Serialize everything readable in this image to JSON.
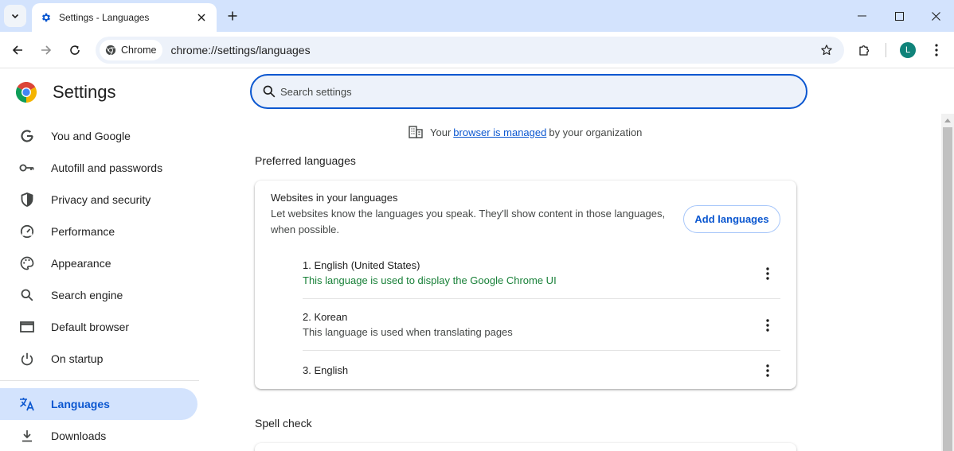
{
  "window": {
    "tab_title": "Settings - Languages"
  },
  "toolbar": {
    "chip_label": "Chrome",
    "url": "chrome://settings/languages",
    "avatar_letter": "L"
  },
  "sidebar": {
    "title": "Settings",
    "items": [
      {
        "label": "You and Google",
        "icon": "google-g-icon"
      },
      {
        "label": "Autofill and passwords",
        "icon": "key-icon"
      },
      {
        "label": "Privacy and security",
        "icon": "shield-icon"
      },
      {
        "label": "Performance",
        "icon": "speedometer-icon"
      },
      {
        "label": "Appearance",
        "icon": "palette-icon"
      },
      {
        "label": "Search engine",
        "icon": "search-icon"
      },
      {
        "label": "Default browser",
        "icon": "browser-window-icon"
      },
      {
        "label": "On startup",
        "icon": "power-icon"
      },
      {
        "label": "Languages",
        "icon": "translate-icon",
        "active": true
      },
      {
        "label": "Downloads",
        "icon": "download-icon"
      }
    ]
  },
  "main": {
    "search_placeholder": "Search settings",
    "managed": {
      "prefix": "Your",
      "link": "browser is managed",
      "suffix": "by your organization"
    },
    "preferred_title": "Preferred languages",
    "card": {
      "title": "Websites in your languages",
      "description": "Let websites know the languages you speak. They'll show content in those languages, when possible.",
      "add_button": "Add languages",
      "languages": [
        {
          "name": "1. English (United States)",
          "note": "This language is used to display the Google Chrome UI"
        },
        {
          "name": "2. Korean",
          "note": "This language is used when translating pages"
        },
        {
          "name": "3. English",
          "note": ""
        }
      ]
    },
    "spell_check_title": "Spell check"
  },
  "colors": {
    "accent": "#0b57d0",
    "titlebar": "#d3e3fd",
    "omnibox": "#edf2fa",
    "ui_language_note": "#188038"
  }
}
